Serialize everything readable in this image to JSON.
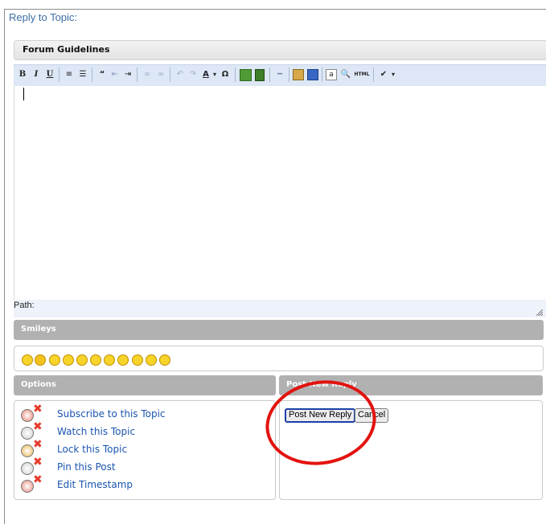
{
  "fieldset": {
    "legend": "Reply to Topic:"
  },
  "guidelines": {
    "label": "Forum Guidelines"
  },
  "toolbar": {
    "buttons": [
      "bold",
      "italic",
      "underline",
      "unordered-list",
      "ordered-list",
      "blockquote",
      "outdent",
      "indent",
      "link",
      "unlink",
      "undo",
      "redo",
      "font-color",
      "special-character",
      "insert-image",
      "insert-media",
      "horizontal-rule",
      "paste-text",
      "paste-word",
      "select-all",
      "find",
      "html-source",
      "spell-check"
    ],
    "bold": "B",
    "italic": "I",
    "underline": "U",
    "omega": "Ω",
    "html": "HTML"
  },
  "editor": {
    "value": ""
  },
  "pathbar": {
    "label": "Path:"
  },
  "smileys": {
    "title": "Smileys",
    "count": 11
  },
  "options": {
    "title": "Options",
    "items": [
      {
        "label": "Subscribe to this Topic",
        "icon": "subscribe-icon"
      },
      {
        "label": "Watch this Topic",
        "icon": "watch-icon"
      },
      {
        "label": "Lock this Topic",
        "icon": "lock-icon"
      },
      {
        "label": "Pin this Post",
        "icon": "pin-icon"
      },
      {
        "label": "Edit Timestamp",
        "icon": "timestamp-icon"
      }
    ]
  },
  "post": {
    "title": "Post New Reply",
    "submit_label": "Post New Reply",
    "cancel_label": "Cancel"
  },
  "annotation": {
    "color": "#e2130f"
  }
}
